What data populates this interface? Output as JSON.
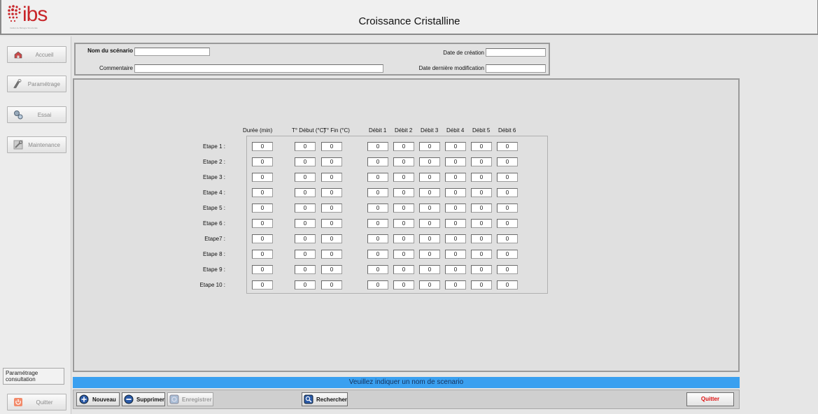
{
  "window": {
    "title": "Croissance Cristalline"
  },
  "logo": {
    "text": "ibs",
    "tagline": "Institut de Biologie Structurale",
    "brand_color": "#c8262a"
  },
  "sidebar": {
    "items": [
      {
        "label": "Accueil",
        "icon": "home-icon"
      },
      {
        "label": "Paramétrage",
        "icon": "tools-icon"
      },
      {
        "label": "Essai",
        "icon": "gears-icon"
      },
      {
        "label": "Maintenance",
        "icon": "wrench-icon"
      }
    ],
    "consult_label": "Paramétrage consultation",
    "quit_label": "Quitter"
  },
  "form": {
    "scenario_label": "Nom du scénario",
    "scenario_value": "",
    "comment_label": "Commentaire",
    "comment_value": "",
    "created_label": "Date de création",
    "created_value": "",
    "modified_label": "Date dernière modification",
    "modified_value": ""
  },
  "table": {
    "headers": {
      "duree": "Durée (min)",
      "t_debut": "T° Début (°C)",
      "t_fin": "T° Fin (°C)",
      "debit1": "Débit 1",
      "debit2": "Débit 2",
      "debit3": "Débit 3",
      "debit4": "Débit 4",
      "debit5": "Débit 5",
      "debit6": "Débit 6"
    },
    "rows": [
      {
        "label": "Etape 1 :",
        "values": [
          "0",
          "0",
          "0",
          "0",
          "0",
          "0",
          "0",
          "0",
          "0"
        ]
      },
      {
        "label": "Etape 2 :",
        "values": [
          "0",
          "0",
          "0",
          "0",
          "0",
          "0",
          "0",
          "0",
          "0"
        ]
      },
      {
        "label": "Etape 3 :",
        "values": [
          "0",
          "0",
          "0",
          "0",
          "0",
          "0",
          "0",
          "0",
          "0"
        ]
      },
      {
        "label": "Etape 4 :",
        "values": [
          "0",
          "0",
          "0",
          "0",
          "0",
          "0",
          "0",
          "0",
          "0"
        ]
      },
      {
        "label": "Etape 5 :",
        "values": [
          "0",
          "0",
          "0",
          "0",
          "0",
          "0",
          "0",
          "0",
          "0"
        ]
      },
      {
        "label": "Etape 6 :",
        "values": [
          "0",
          "0",
          "0",
          "0",
          "0",
          "0",
          "0",
          "0",
          "0"
        ]
      },
      {
        "label": "Etape7 :",
        "values": [
          "0",
          "0",
          "0",
          "0",
          "0",
          "0",
          "0",
          "0",
          "0"
        ]
      },
      {
        "label": "Etape 8 :",
        "values": [
          "0",
          "0",
          "0",
          "0",
          "0",
          "0",
          "0",
          "0",
          "0"
        ]
      },
      {
        "label": "Etape 9 :",
        "values": [
          "0",
          "0",
          "0",
          "0",
          "0",
          "0",
          "0",
          "0",
          "0"
        ]
      },
      {
        "label": "Etape 10 :",
        "values": [
          "0",
          "0",
          "0",
          "0",
          "0",
          "0",
          "0",
          "0",
          "0"
        ]
      }
    ]
  },
  "status": {
    "message": "Veuillez indiquer un nom de scenario",
    "color": "#3aa0f0"
  },
  "toolbar": {
    "new_label": "Nouveau",
    "delete_label": "Supprimer",
    "save_label": "Enregistrer",
    "search_label": "Rechercher",
    "quit_label": "Quitter"
  }
}
